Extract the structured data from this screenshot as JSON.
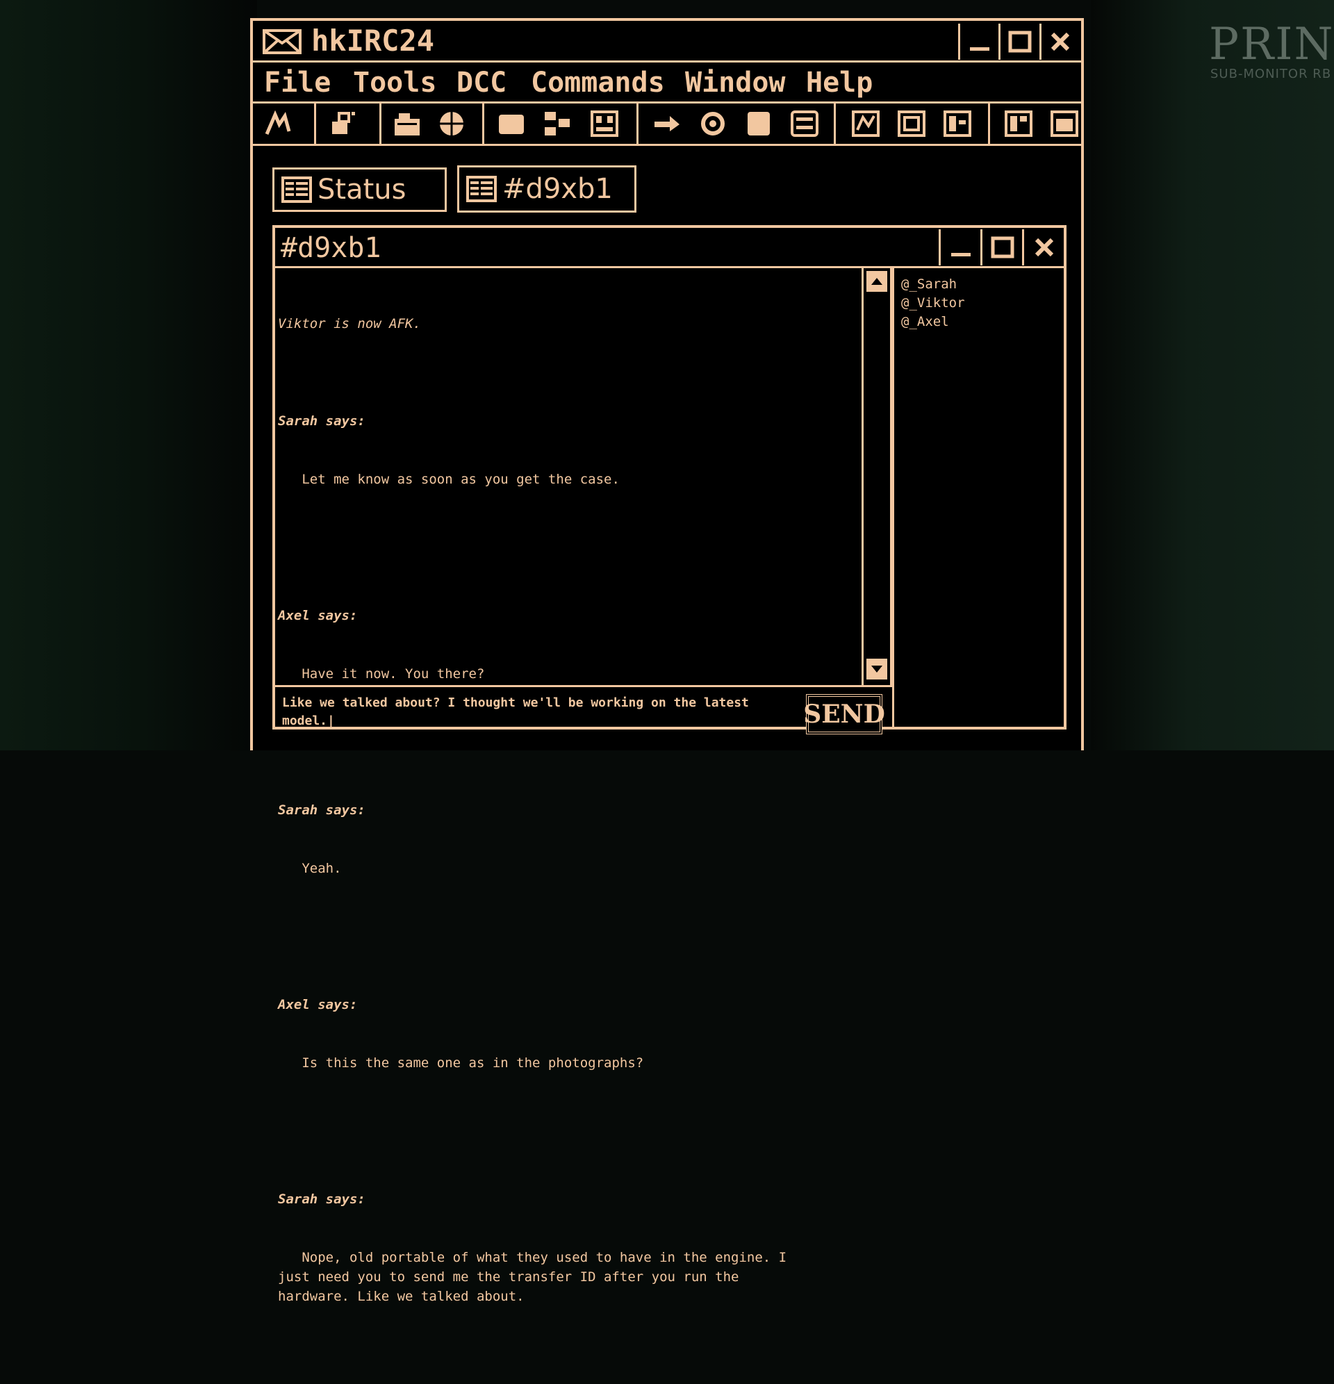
{
  "app": {
    "title": "hkIRC24"
  },
  "menu": [
    "File",
    "Tools",
    "DCC",
    "Commands",
    "Window",
    "Help"
  ],
  "toolbar_icons": [
    "wand-icon",
    "tool-icon",
    "folder-icon",
    "globe-icon",
    "card-icon",
    "network-icon",
    "grid-icon",
    "pointer-icon",
    "gear-icon",
    "blank-icon",
    "list-icon",
    "chart-icon",
    "chart2-icon",
    "chart3-icon",
    "panel-icon",
    "window-icon"
  ],
  "tabs": [
    {
      "label": "Status",
      "icon": "status-icon"
    },
    {
      "label": "#d9xb1",
      "icon": "channel-icon"
    }
  ],
  "channel": {
    "title": "#d9xb1",
    "system_message": "Viktor is now AFK.",
    "messages": [
      {
        "who": "Sarah says:",
        "text": "   Let me know as soon as you get the case."
      },
      {
        "who": "Axel says:",
        "text": "   Have it now. You there?"
      },
      {
        "who": "Sarah says:",
        "text": "   Yeah."
      },
      {
        "who": "Axel says:",
        "text": "   Is this the same one as in the photographs?"
      },
      {
        "who": "Sarah says:",
        "text": "   Nope, old portable of what they used to have in the engine. I\njust need you to send me the transfer ID after you run the\nhardware. Like we talked about."
      }
    ],
    "users": [
      "@_Sarah",
      "@_Viktor",
      "@_Axel"
    ],
    "input_value": "Like we talked about? I thought we'll be working on the latest\nmodel.|",
    "send_label": "SEND"
  },
  "background": {
    "sign": "PRINT-I",
    "sign_sub": "SUB-MONITOR RB"
  },
  "colors": {
    "amber": "#f2c7a0",
    "background": "#000000"
  }
}
